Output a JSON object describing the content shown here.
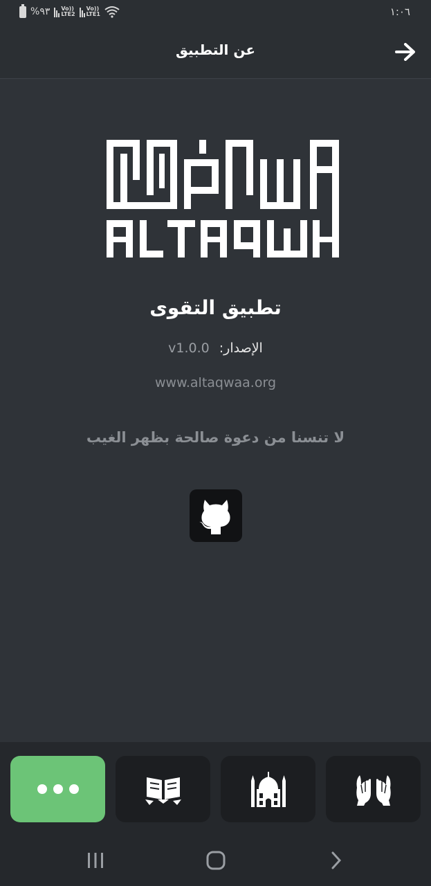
{
  "status_bar": {
    "battery_percent": "%٩٣",
    "sim1_label_top": "Vo))",
    "sim1_label_bottom": "LTE2",
    "sim2_label_top": "Vo))",
    "sim2_label_bottom": "LTE1",
    "time": "١:٠٦"
  },
  "header": {
    "title": "عن التطبيق",
    "back_icon": "arrow-right-icon"
  },
  "logo": {
    "latin_text": "ALTAQWA",
    "icon": "altaqwa-logo"
  },
  "app": {
    "name": "تطبيق التقوى",
    "version_label": "الإصدار:",
    "version_value": "v1.0.0",
    "website": "www.altaqwaa.org",
    "dua_text": "لا تنسنا من دعوة صالحة بظهر الغيب",
    "github_icon": "github-icon"
  },
  "bottom_nav": {
    "items": [
      {
        "icon": "more-dots-icon",
        "active": true
      },
      {
        "icon": "quran-book-icon",
        "active": false
      },
      {
        "icon": "mosque-icon",
        "active": false
      },
      {
        "icon": "praying-hands-icon",
        "active": false
      }
    ],
    "active_color": "#6cc477"
  },
  "system_nav": {
    "recents_icon": "recents-icon",
    "home_icon": "home-icon",
    "back_icon": "chevron-right-icon"
  },
  "colors": {
    "background": "#2f3338",
    "header": "#2b2f33",
    "muted_text": "#8b8f94",
    "accent": "#6cc477"
  }
}
